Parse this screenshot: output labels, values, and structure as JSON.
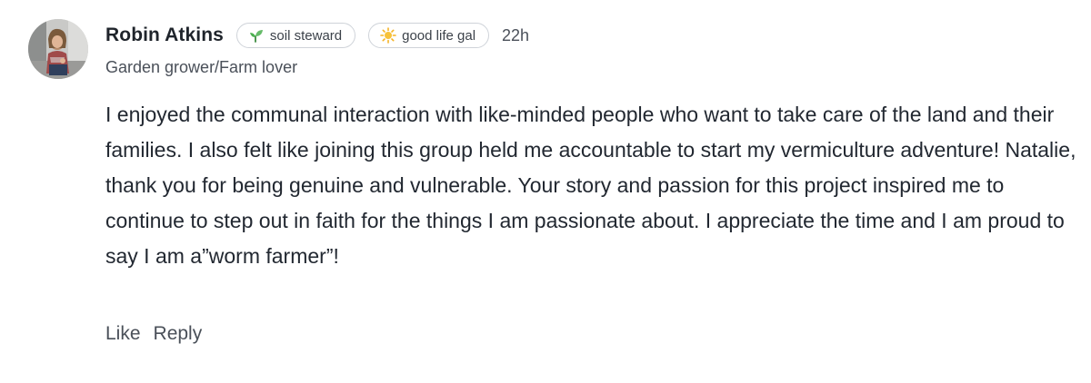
{
  "comment": {
    "author": {
      "name": "Robin Atkins",
      "headline": "Garden grower/Farm lover",
      "avatar_icon": "user-avatar-photo"
    },
    "badges": [
      {
        "label": "soil steward",
        "icon": "seedling-icon",
        "icon_color": "#4caf50"
      },
      {
        "label": "good life gal",
        "icon": "sun-icon",
        "icon_color": "#f5b324"
      }
    ],
    "timestamp": "22h",
    "text": "I enjoyed the communal interaction with like-minded people who want to take care of the land and their families. I also felt like joining this group held me accountable to start my vermiculture adventure! Natalie, thank you for being genuine and vulnerable. Your story and passion for this project inspired me to continue to step out in faith for the things I am passionate about. I appreciate the time and I am proud to say I am a”worm farmer”!",
    "actions": {
      "like_label": "Like",
      "reply_label": "Reply"
    }
  }
}
